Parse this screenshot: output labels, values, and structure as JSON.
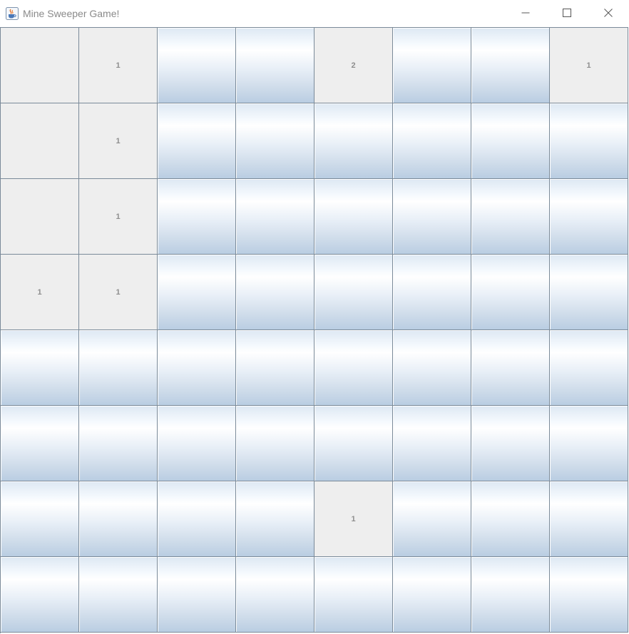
{
  "window": {
    "title": "Mine Sweeper Game!",
    "icon": "java-cup-icon",
    "controls": [
      "minimize-icon",
      "maximize-icon",
      "close-icon"
    ]
  },
  "board": {
    "rows": 8,
    "cols": 8,
    "cells": [
      [
        {
          "state": "open",
          "value": ""
        },
        {
          "state": "open",
          "value": "1"
        },
        {
          "state": "hidden",
          "value": ""
        },
        {
          "state": "hidden",
          "value": ""
        },
        {
          "state": "open",
          "value": "2"
        },
        {
          "state": "hidden",
          "value": ""
        },
        {
          "state": "hidden",
          "value": ""
        },
        {
          "state": "open",
          "value": "1"
        }
      ],
      [
        {
          "state": "open",
          "value": ""
        },
        {
          "state": "open",
          "value": "1"
        },
        {
          "state": "hidden",
          "value": ""
        },
        {
          "state": "hidden",
          "value": ""
        },
        {
          "state": "hidden",
          "value": ""
        },
        {
          "state": "hidden",
          "value": ""
        },
        {
          "state": "hidden",
          "value": ""
        },
        {
          "state": "hidden",
          "value": ""
        }
      ],
      [
        {
          "state": "open",
          "value": ""
        },
        {
          "state": "open",
          "value": "1"
        },
        {
          "state": "hidden",
          "value": ""
        },
        {
          "state": "hidden",
          "value": ""
        },
        {
          "state": "hidden",
          "value": ""
        },
        {
          "state": "hidden",
          "value": ""
        },
        {
          "state": "hidden",
          "value": ""
        },
        {
          "state": "hidden",
          "value": ""
        }
      ],
      [
        {
          "state": "open",
          "value": "1"
        },
        {
          "state": "open",
          "value": "1"
        },
        {
          "state": "hidden",
          "value": ""
        },
        {
          "state": "hidden",
          "value": ""
        },
        {
          "state": "hidden",
          "value": ""
        },
        {
          "state": "hidden",
          "value": ""
        },
        {
          "state": "hidden",
          "value": ""
        },
        {
          "state": "hidden",
          "value": ""
        }
      ],
      [
        {
          "state": "hidden",
          "value": ""
        },
        {
          "state": "hidden",
          "value": ""
        },
        {
          "state": "hidden",
          "value": ""
        },
        {
          "state": "hidden",
          "value": ""
        },
        {
          "state": "hidden",
          "value": ""
        },
        {
          "state": "hidden",
          "value": ""
        },
        {
          "state": "hidden",
          "value": ""
        },
        {
          "state": "hidden",
          "value": ""
        }
      ],
      [
        {
          "state": "hidden",
          "value": ""
        },
        {
          "state": "hidden",
          "value": ""
        },
        {
          "state": "hidden",
          "value": ""
        },
        {
          "state": "hidden",
          "value": ""
        },
        {
          "state": "hidden",
          "value": ""
        },
        {
          "state": "hidden",
          "value": ""
        },
        {
          "state": "hidden",
          "value": ""
        },
        {
          "state": "hidden",
          "value": ""
        }
      ],
      [
        {
          "state": "hidden",
          "value": ""
        },
        {
          "state": "hidden",
          "value": ""
        },
        {
          "state": "hidden",
          "value": ""
        },
        {
          "state": "hidden",
          "value": ""
        },
        {
          "state": "open",
          "value": "1"
        },
        {
          "state": "hidden",
          "value": ""
        },
        {
          "state": "hidden",
          "value": ""
        },
        {
          "state": "hidden",
          "value": ""
        }
      ],
      [
        {
          "state": "hidden",
          "value": ""
        },
        {
          "state": "hidden",
          "value": ""
        },
        {
          "state": "hidden",
          "value": ""
        },
        {
          "state": "hidden",
          "value": ""
        },
        {
          "state": "hidden",
          "value": ""
        },
        {
          "state": "hidden",
          "value": ""
        },
        {
          "state": "hidden",
          "value": ""
        },
        {
          "state": "hidden",
          "value": ""
        }
      ]
    ]
  },
  "colors": {
    "grid_line": "#7a8a99",
    "open_cell": "#eeeeee",
    "number_text": "#8e8e8e",
    "title_text": "#8a8a8a"
  }
}
